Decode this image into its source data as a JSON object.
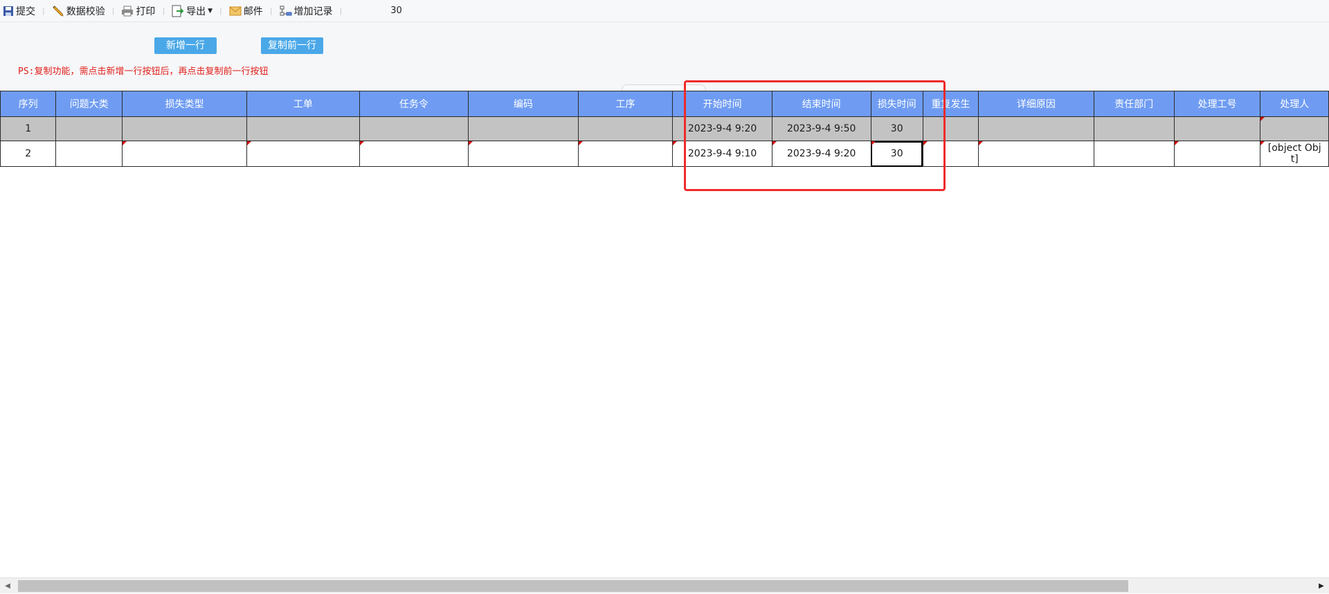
{
  "toolbar": {
    "submit": "提交",
    "validate": "数据校验",
    "print": "打印",
    "export": "导出",
    "mail": "邮件",
    "add_record": "增加记录",
    "counter": "30"
  },
  "actions": {
    "add_row": "新增一行",
    "copy_prev_row": "复制前一行"
  },
  "note": "PS:复制功能，需点击新增一行按钮后，再点击复制前一行按钮",
  "table": {
    "headers": [
      "序列",
      "问题大类",
      "损失类型",
      "工单",
      "任务令",
      "编码",
      "工序",
      "开始时间",
      "结束时间",
      "损失时间",
      "重复发生",
      "详细原因",
      "责任部门",
      "处理工号",
      "处理人"
    ],
    "rows": [
      [
        "1",
        "",
        "",
        "",
        "",
        "",
        "",
        "2023-9-4 9:20",
        "2023-9-4 9:50",
        "30",
        "",
        "",
        "",
        "",
        ""
      ],
      [
        "2",
        "",
        "",
        "",
        "",
        "",
        "",
        "2023-9-4 9:10",
        "2023-9-4 9:20",
        "30",
        "",
        "",
        "",
        "",
        "[object Obj\nt]"
      ]
    ]
  },
  "colors": {
    "header_bg": "#6f9cf2",
    "row_readonly_bg": "#c3c3c3",
    "button_bg": "#4aa8e8",
    "highlight": "#ef2a2a",
    "note": "#e0201b"
  }
}
